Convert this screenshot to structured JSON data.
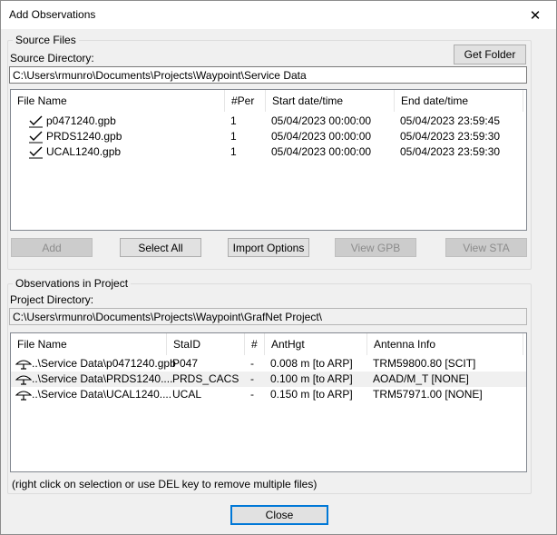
{
  "window": {
    "title": "Add Observations",
    "close_glyph": "✕"
  },
  "source": {
    "group_label": "Source Files",
    "dir_label": "Source Directory:",
    "dir_value": "C:\\Users\\rmunro\\Documents\\Projects\\Waypoint\\Service Data",
    "get_folder_label": "Get Folder",
    "columns": [
      "File Name",
      "#Per",
      "Start date/time",
      "End date/time"
    ],
    "rows": [
      {
        "name": "p0471240.gpb",
        "per": "1",
        "start": "05/04/2023 00:00:00",
        "end": "05/04/2023 23:59:45",
        "checked": true
      },
      {
        "name": "PRDS1240.gpb",
        "per": "1",
        "start": "05/04/2023 00:00:00",
        "end": "05/04/2023 23:59:30",
        "checked": true
      },
      {
        "name": "UCAL1240.gpb",
        "per": "1",
        "start": "05/04/2023 00:00:00",
        "end": "05/04/2023 23:59:30",
        "checked": true
      }
    ],
    "buttons": {
      "add": "Add",
      "select_all": "Select All",
      "import_options": "Import Options",
      "view_gpb": "View GPB",
      "view_sta": "View STA"
    }
  },
  "project": {
    "group_label": "Observations in Project",
    "dir_label": "Project Directory:",
    "dir_value": "C:\\Users\\rmunro\\Documents\\Projects\\Waypoint\\GrafNet Project\\",
    "columns": [
      "File Name",
      "StaID",
      "#",
      "AntHgt",
      "Antenna Info"
    ],
    "rows": [
      {
        "name": "..\\Service Data\\p0471240.gpb",
        "staid": "P047",
        "num": "-",
        "anthgt": "0.008 m [to ARP]",
        "antenna": "TRM59800.80 [SCIT]",
        "selected": false
      },
      {
        "name": "..\\Service Data\\PRDS1240....",
        "staid": "PRDS_CACS",
        "num": "-",
        "anthgt": "0.100 m [to ARP]",
        "antenna": "AOAD/M_T [NONE]",
        "selected": true
      },
      {
        "name": "..\\Service Data\\UCAL1240....",
        "staid": "UCAL",
        "num": "-",
        "anthgt": "0.150 m [to ARP]",
        "antenna": "TRM57971.00 [NONE]",
        "selected": false
      }
    ],
    "hint": "(right click on selection or use DEL key to remove multiple files)"
  },
  "footer": {
    "close_label": "Close"
  },
  "icons": {
    "file_check": "checkmark-icon",
    "antenna": "antenna-icon",
    "window_close": "close-icon"
  },
  "colors": {
    "default_button_border": "#0078d7",
    "selected_row": "#f0f0f0"
  }
}
